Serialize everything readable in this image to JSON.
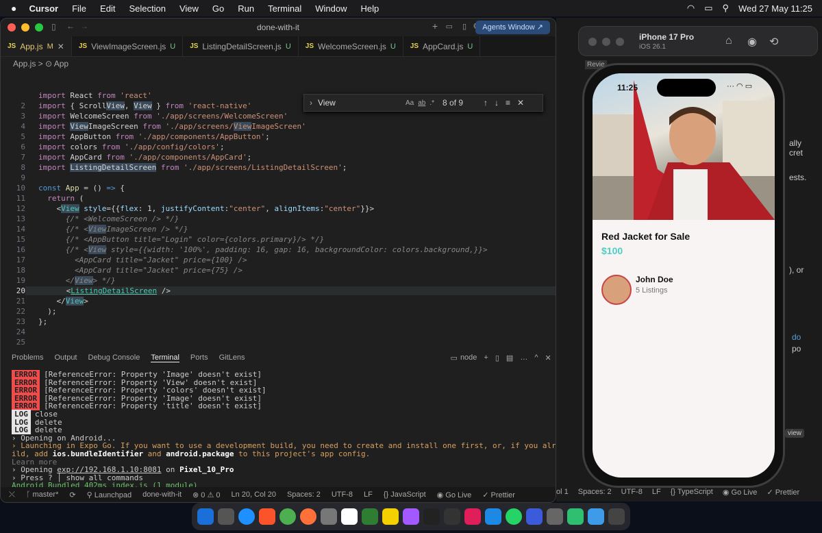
{
  "menubar": {
    "apple": "",
    "app": "Cursor",
    "items": [
      "File",
      "Edit",
      "Selection",
      "View",
      "Go",
      "Run",
      "Terminal",
      "Window",
      "Help"
    ],
    "clock": "Wed 27 May  11:25"
  },
  "vscode": {
    "title": "done-with-it",
    "agents_window": "Agents Window ↗",
    "tabs": [
      {
        "name": "App.js",
        "status": "M"
      },
      {
        "name": "ViewImageScreen.js",
        "status": "U"
      },
      {
        "name": "ListingDetailScreen.js",
        "status": "U"
      },
      {
        "name": "WelcomeScreen.js",
        "status": "U"
      },
      {
        "name": "AppCard.js",
        "status": "U"
      }
    ],
    "breadcrumb": "App.js > ⊙ App",
    "find": {
      "query": "View",
      "count": "8 of 9",
      "aa": "Aa",
      "ab": "ab",
      "regex": ".*"
    },
    "line_numbers": [
      "",
      "2",
      "3",
      "4",
      "5",
      "6",
      "7",
      "8",
      "9",
      "10",
      "11",
      "12",
      "13",
      "14",
      "15",
      "16",
      "17",
      "18",
      "19",
      "20",
      "21",
      "22",
      "23",
      "24",
      "25"
    ],
    "panel_tabs": [
      "Problems",
      "Output",
      "Debug Console",
      "Terminal",
      "Ports",
      "GitLens"
    ],
    "terminal_shell": "node",
    "terminal": {
      "errors": [
        "[ReferenceError: Property 'Image' doesn't exist]",
        "[ReferenceError: Property 'View' doesn't exist]",
        "[ReferenceError: Property 'colors' doesn't exist]",
        "[ReferenceError: Property 'Image' doesn't exist]",
        "[ReferenceError: Property 'title' doesn't exist]"
      ],
      "error_label": "ERROR",
      "log_label": "LOG",
      "logs": [
        "close",
        "delete",
        "delete"
      ],
      "opening": "› Opening on Android...",
      "launching_1": "› Launching in Expo Go. If you want to use a development build, you need to create and install one first, or, if you already have a bu",
      "launching_2a": "ild, add ",
      "launching_ios": "ios.bundleIdentifier",
      "launching_and": " and ",
      "launching_android": "android.package",
      "launching_2b": " to this project's app config.",
      "learn_more": "Learn more",
      "opening_exp": "› Opening ",
      "exp_url": "exp://192.168.1.10:8081",
      "on": " on ",
      "device": "Pixel_10_Pro",
      "press": "› Press ? │ show all commands",
      "bundled_a": "Android",
      "bundled_b": " Bundled 402ms index.js (1 module)",
      "cursor": "▯"
    },
    "statusbar": [
      "⤬",
      "ᚴ master*",
      "⟳",
      "⚲ Launchpad",
      "done-with-it",
      "⊗ 0 ⚠ 0",
      "Ln 20, Col 20",
      "Spaces: 2",
      "UTF-8",
      "LF",
      "{} JavaScript",
      "◉ Go Live",
      "✓ Prettier"
    ]
  },
  "simulator": {
    "device": "iPhone 17 Pro",
    "os": "iOS 26.1",
    "time": "11:25",
    "listing_title": "Red Jacket for Sale",
    "listing_price": "$100",
    "seller_name": "John Doe",
    "seller_listings": "5 Listings"
  },
  "right_bg_text": {
    "review": "Revie",
    "ally": "ally",
    "cret": "cret",
    "ests": "ests.",
    "or": "), or",
    "do": "do",
    "po": "po",
    "view": "view",
    "status_tail": [
      "ol 1",
      "Spaces: 2",
      "UTF-8",
      "LF",
      "{} TypeScript",
      "◉ Go Live",
      "✓ Prettier"
    ]
  },
  "colors": {
    "accent": "#4ecdc4",
    "error": "#f14c4c",
    "active_tab": "#e0c870"
  }
}
